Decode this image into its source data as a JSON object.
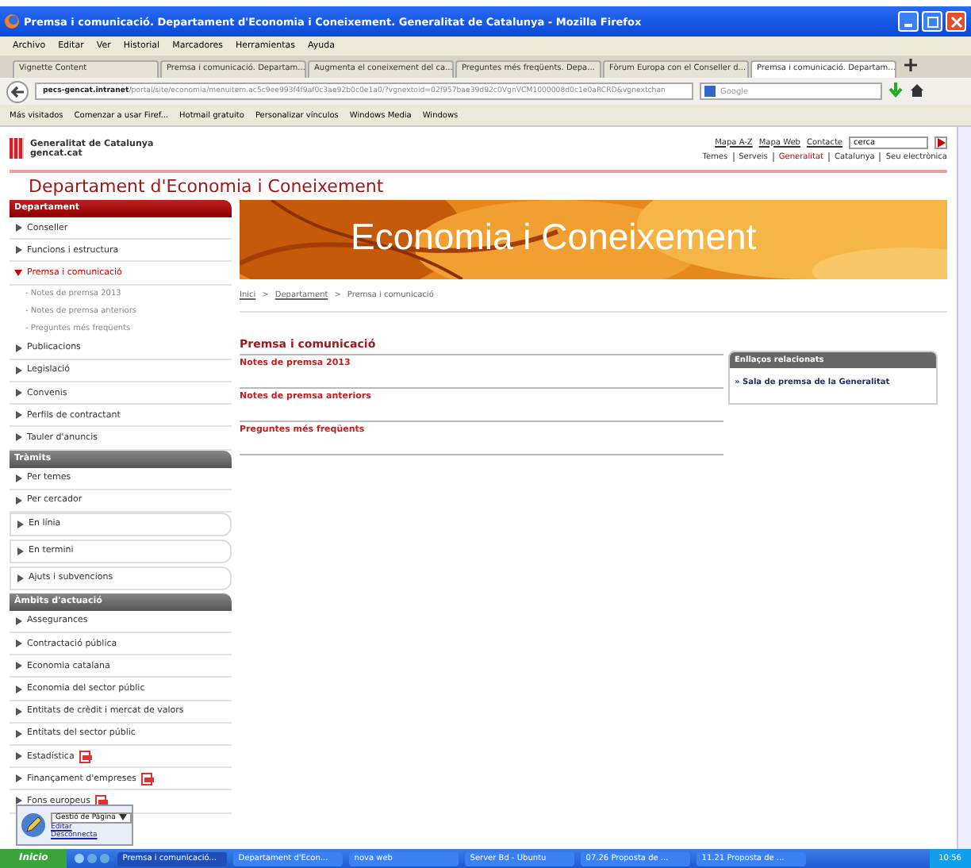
{
  "window": {
    "title": "Premsa i comunicació. Departament d'Economia i Coneixement. Generalitat de Catalunya - Mozilla Firefox"
  },
  "menu": [
    "Archivo",
    "Editar",
    "Ver",
    "Historial",
    "Marcadores",
    "Herramientas",
    "Ayuda"
  ],
  "tabs": [
    {
      "label": "Vignette Content",
      "selected": false
    },
    {
      "label": "Premsa i comunicació. Departam...",
      "selected": false
    },
    {
      "label": "Augmenta el coneixement del ca...",
      "selected": false
    },
    {
      "label": "Preguntes més freqüents. Depa...",
      "selected": false
    },
    {
      "label": "Fòrum Europa con el Conseller d...",
      "selected": false
    },
    {
      "label": "Premsa i comunicació. Departam...",
      "selected": true
    }
  ],
  "address": {
    "host": "pecs-gencat.intranet",
    "path": "/portal/site/economia/menuitem.ac5c9ee993f4f9af0c3ae92b0c0e1a0/?vgnextoid=02f957bae39d92c0VgnVCM1000008d0c1e0aRCRD&vgnextchan"
  },
  "search": {
    "placeholder": "Google"
  },
  "bookmarks": [
    "Más visitados",
    "Comenzar a usar Firef...",
    "Hotmail gratuito",
    "Personalizar vínculos",
    "Windows Media",
    "Windows"
  ],
  "page": {
    "logo": {
      "line1": "Generalitat de Catalunya",
      "line2": "gencat.cat"
    },
    "top_links": [
      "Mapa A-Z",
      "Mapa Web",
      "Contacte"
    ],
    "site_search": {
      "value": "cerca"
    },
    "top_nav": [
      {
        "label": "Temes",
        "selected": false
      },
      {
        "label": "Serveis",
        "selected": false
      },
      {
        "label": "Generalitat",
        "selected": true
      },
      {
        "label": "Catalunya",
        "selected": false
      },
      {
        "label": "Seu electrònica",
        "selected": false
      }
    ],
    "department": "Departament d'Economia i Coneixement",
    "sidebar": [
      {
        "kind": "header",
        "label": "Departament"
      },
      {
        "kind": "item",
        "label": "Conseller",
        "expanded": false
      },
      {
        "kind": "item",
        "label": "Funcions i estructura",
        "expanded": false
      },
      {
        "kind": "item",
        "label": "Premsa i comunicació",
        "expanded": true,
        "children": [
          {
            "label": "- Notes de premsa 2013"
          },
          {
            "label": "- Notes de premsa anteriors"
          },
          {
            "label": "- Preguntes més freqüents"
          }
        ]
      },
      {
        "kind": "item",
        "label": "Publicacions",
        "expanded": false
      },
      {
        "kind": "item",
        "label": "Legislació",
        "expanded": false
      },
      {
        "kind": "item",
        "label": "Convenis",
        "expanded": false
      },
      {
        "kind": "item",
        "label": "Perfils de contractant",
        "expanded": false
      },
      {
        "kind": "item",
        "label": "Tauler d'anuncis",
        "expanded": false
      },
      {
        "kind": "header",
        "label": "Tràmits"
      },
      {
        "kind": "item",
        "label": "Per temes",
        "expanded": false
      },
      {
        "kind": "item",
        "label": "Per cercador",
        "expanded": false
      },
      {
        "kind": "boxed",
        "label": "En línia"
      },
      {
        "kind": "boxed",
        "label": "En termini"
      },
      {
        "kind": "boxed",
        "label": "Ajuts i subvencions"
      },
      {
        "kind": "header",
        "label": "Àmbits d'actuació"
      },
      {
        "kind": "item",
        "label": "Assegurances",
        "expanded": false
      },
      {
        "kind": "item",
        "label": "Contractació pública",
        "expanded": false
      },
      {
        "kind": "item",
        "label": "Economia catalana",
        "expanded": false
      },
      {
        "kind": "item",
        "label": "Economia del sector públic",
        "expanded": false
      },
      {
        "kind": "item",
        "label": "Entitats de crèdit i mercat de valors",
        "expanded": false
      },
      {
        "kind": "item",
        "label": "Entitats del sector públic",
        "expanded": false
      },
      {
        "kind": "item",
        "label": "Estadística",
        "expanded": false,
        "pdf": true
      },
      {
        "kind": "item",
        "label": "Finançament d'empreses",
        "expanded": false,
        "pdf": true
      },
      {
        "kind": "item",
        "label": "Fons europeus",
        "expanded": false,
        "pdf": true
      }
    ],
    "banner": {
      "title": "Economia i Coneixement"
    },
    "breadcrumb": {
      "separator": ">",
      "items": [
        "Inici",
        "Departament",
        "Premsa i comunicació"
      ]
    },
    "section_title": "Premsa i comunicació",
    "links": [
      "Notes de premsa 2013",
      "Notes de premsa anteriors",
      "Preguntes més freqüents"
    ],
    "related": {
      "title": "Enllaços relacionats",
      "links": [
        "» Sala de premsa de la Generalitat"
      ]
    },
    "editor_popup": {
      "dropdown": "Gestió de Pàgina",
      "links": [
        "Editar",
        "Desconnecta"
      ]
    }
  },
  "taskbar": {
    "start": "Inicio",
    "items": [
      {
        "label": "Premsa i comunicació...",
        "selected": true
      },
      {
        "label": "Departament d'Econ...",
        "selected": false
      },
      {
        "label": "nova web",
        "selected": false
      },
      {
        "label": "Server Bd - Ubuntu",
        "selected": false
      },
      {
        "label": "07.26 Proposta de ...",
        "selected": false
      },
      {
        "label": "11.21 Proposta de ...",
        "selected": false
      }
    ],
    "clock": "10:56"
  }
}
